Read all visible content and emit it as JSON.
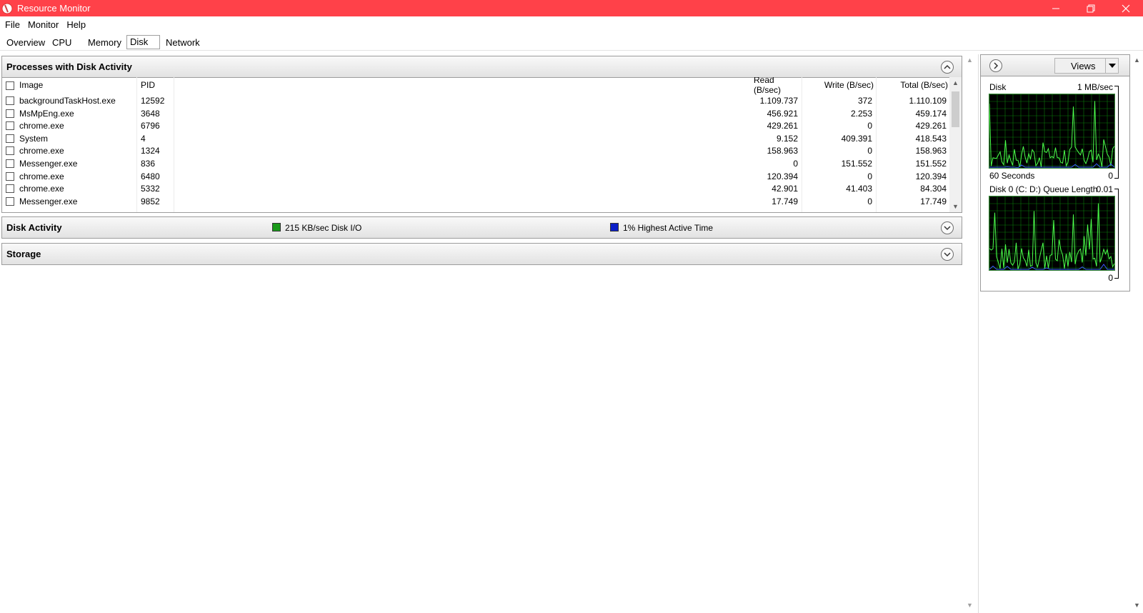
{
  "window": {
    "title": "Resource Monitor",
    "accent_color": "#ff4149"
  },
  "menu": [
    "File",
    "Monitor",
    "Help"
  ],
  "tabs": [
    {
      "label": "Overview"
    },
    {
      "label": "CPU"
    },
    {
      "label": "Memory"
    },
    {
      "label": "Disk",
      "active": true
    },
    {
      "label": "Network"
    }
  ],
  "processes": {
    "title": "Processes with Disk Activity",
    "columns": {
      "image": "Image",
      "pid": "PID",
      "read": "Read (B/sec)",
      "write": "Write (B/sec)",
      "total": "Total (B/sec)"
    },
    "rows": [
      {
        "image": "backgroundTaskHost.exe",
        "pid": "12592",
        "read": "1.109.737",
        "write": "372",
        "total": "1.110.109"
      },
      {
        "image": "MsMpEng.exe",
        "pid": "3648",
        "read": "456.921",
        "write": "2.253",
        "total": "459.174"
      },
      {
        "image": "chrome.exe",
        "pid": "6796",
        "read": "429.261",
        "write": "0",
        "total": "429.261"
      },
      {
        "image": "System",
        "pid": "4",
        "read": "9.152",
        "write": "409.391",
        "total": "418.543"
      },
      {
        "image": "chrome.exe",
        "pid": "1324",
        "read": "158.963",
        "write": "0",
        "total": "158.963"
      },
      {
        "image": "Messenger.exe",
        "pid": "836",
        "read": "0",
        "write": "151.552",
        "total": "151.552"
      },
      {
        "image": "chrome.exe",
        "pid": "6480",
        "read": "120.394",
        "write": "0",
        "total": "120.394"
      },
      {
        "image": "chrome.exe",
        "pid": "5332",
        "read": "42.901",
        "write": "41.403",
        "total": "84.304"
      },
      {
        "image": "Messenger.exe",
        "pid": "9852",
        "read": "17.749",
        "write": "0",
        "total": "17.749"
      }
    ]
  },
  "disk_activity": {
    "title": "Disk Activity",
    "io_label": "215 KB/sec Disk I/O",
    "io_color": "#1a9a1a",
    "active_label": "1% Highest Active Time",
    "active_color": "#0a1ec8"
  },
  "storage": {
    "title": "Storage"
  },
  "side_panel": {
    "views_label": "Views",
    "graph1": {
      "title": "Disk",
      "max": "1 MB/sec",
      "footer_left": "60 Seconds",
      "footer_right": "0"
    },
    "graph2": {
      "title": "Disk 0 (C: D:) Queue Length",
      "max": "0.01",
      "footer_right": "0"
    }
  }
}
